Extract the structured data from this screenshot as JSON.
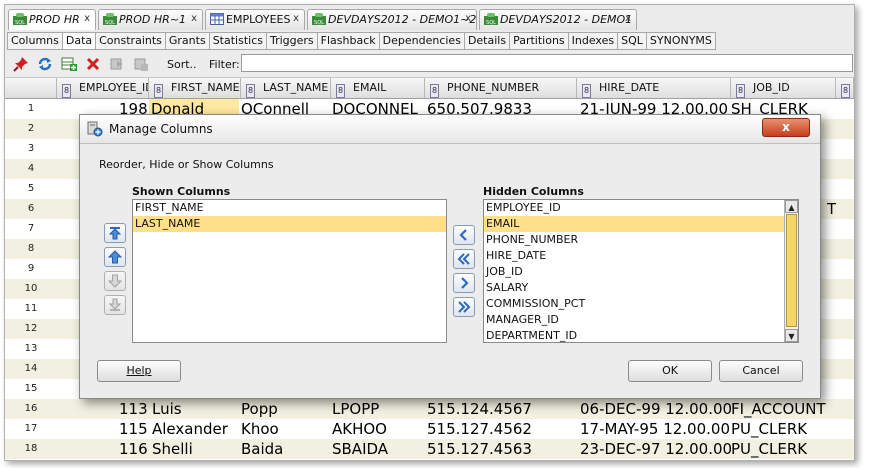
{
  "doc_tabs": [
    {
      "label": "PROD HR",
      "icon": "sql-connection-icon",
      "italic": true
    },
    {
      "label": "PROD HR~1",
      "icon": "sql-connection-icon",
      "italic": true
    },
    {
      "label": "EMPLOYEES",
      "icon": "table-icon",
      "italic": false
    },
    {
      "label": "DEVDAYS2012 - DEMO1~2",
      "icon": "sql-connection-icon",
      "italic": true
    },
    {
      "label": "DEVDAYS2012 - DEMO1",
      "icon": "sql-connection-icon",
      "italic": true
    }
  ],
  "close_glyph": "x",
  "sub_tabs": [
    "Columns",
    "Data",
    "Constraints",
    "Grants",
    "Statistics",
    "Triggers",
    "Flashback",
    "Dependencies",
    "Details",
    "Partitions",
    "Indexes",
    "SQL",
    "SYNONYMS"
  ],
  "active_sub_tab": "Data",
  "toolbar": {
    "icons": [
      "pin-icon",
      "refresh-icon",
      "insert-row-icon",
      "delete-row-icon",
      "commit-icon",
      "rollback-icon"
    ],
    "sort_label": "Sort..",
    "filter_label": "Filter:",
    "filter_value": ""
  },
  "grid": {
    "columns": [
      "EMPLOYEE_ID",
      "FIRST_NAME",
      "LAST_NAME",
      "EMAIL",
      "PHONE_NUMBER",
      "HIRE_DATE",
      "JOB_ID"
    ],
    "column_badge": "8",
    "row_numbers": [
      "1",
      "2",
      "3",
      "4",
      "5",
      "6",
      "7",
      "8",
      "9",
      "10",
      "11",
      "12",
      "13",
      "14",
      "15",
      "16",
      "17",
      "18"
    ],
    "visible_rows": [
      {
        "n": "1",
        "cells": [
          "198",
          "Donald",
          "OConnell",
          "DOCONNEL",
          "650.507.9833",
          "21-JUN-99 12.00.00",
          "SH_CLERK"
        ]
      },
      {
        "n": "16",
        "cells": [
          "113",
          "Luis",
          "Popp",
          "LPOPP",
          "515.124.4567",
          "06-DEC-99 12.00.00",
          "FI_ACCOUNT"
        ]
      },
      {
        "n": "17",
        "cells": [
          "115",
          "Alexander",
          "Khoo",
          "AKHOO",
          "515.127.4562",
          "17-MAY-95 12.00.00",
          "PU_CLERK"
        ]
      },
      {
        "n": "18",
        "cells": [
          "116",
          "Shelli",
          "Baida",
          "SBAIDA",
          "515.127.4563",
          "23-DEC-97 12.00.00",
          "PU_CLERK"
        ]
      }
    ],
    "partial_right": {
      "row6": "T"
    }
  },
  "dialog": {
    "title": "Manage Columns",
    "instruction": "Reorder, Hide or Show Columns",
    "shown_header": "Shown Columns",
    "hidden_header": "Hidden Columns",
    "shown_columns": [
      "FIRST_NAME",
      "LAST_NAME"
    ],
    "shown_selected": "LAST_NAME",
    "hidden_columns": [
      "EMPLOYEE_ID",
      "EMAIL",
      "PHONE_NUMBER",
      "HIRE_DATE",
      "JOB_ID",
      "SALARY",
      "COMMISSION_PCT",
      "MANAGER_ID",
      "DEPARTMENT_ID"
    ],
    "hidden_selected": "EMAIL",
    "help_label": "Help",
    "ok_label": "OK",
    "cancel_label": "Cancel",
    "close_glyph": "x"
  },
  "colors": {
    "selection": "#ffe08a",
    "row_highlight": "#ffe9a0",
    "alt_row": "#f2f0e0",
    "scroll_thumb": "#f5d66a"
  }
}
